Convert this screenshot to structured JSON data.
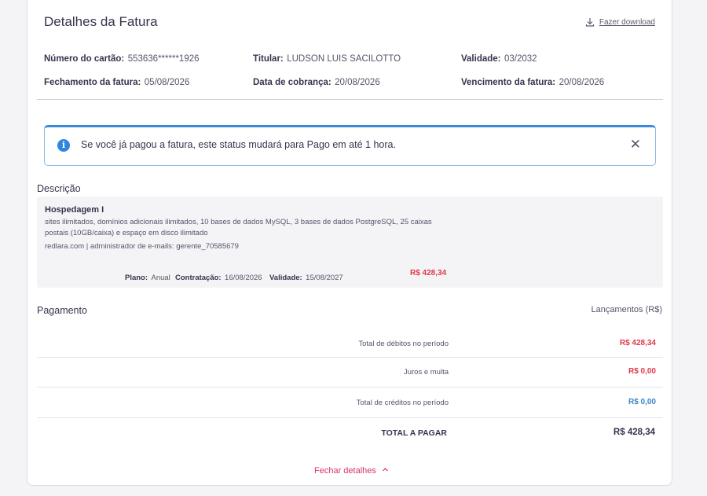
{
  "header": {
    "title": "Detalhes da Fatura",
    "download_label": "Fazer download",
    "download_icon": "download-icon"
  },
  "card_info": {
    "card_number_label": "Número do cartão:",
    "card_number_value": "553636******1926",
    "holder_label": "Titular:",
    "holder_value": "LUDSON LUIS SACILOTTO",
    "validity_label": "Validade:",
    "validity_value": "03/2032",
    "closing_label": "Fechamento da fatura:",
    "closing_value": "05/08/2026",
    "billing_label": "Data de cobrança:",
    "billing_value": "20/08/2026",
    "due_label": "Vencimento da fatura:",
    "due_value": "20/08/2026"
  },
  "alert": {
    "icon": "info-icon",
    "text": "Se você já pagou a fatura, este status mudará para Pago em até 1 hora.",
    "close_icon": "close-icon"
  },
  "description": {
    "section_title": "Descrição",
    "item_name": "Hospedagem I",
    "item_details": "sites ilimitados, domínios adicionais ilimitados, 10 bases de dados MySQL, 3 bases de dados PostgreSQL, 25 caixas postais (10GB/caixa) e espaço em disco ilimitado",
    "domain_line": "redlara.com | administrador de e-mails: gerente_70585679",
    "plan_label": "Plano:",
    "plan_value": "Anual",
    "contract_label": "Contratação:",
    "contract_value": "16/08/2026",
    "validity_label": "Validade:",
    "validity_value": "15/08/2027",
    "price": "R$ 428,34"
  },
  "payment": {
    "section_title": "Pagamento",
    "column_header": "Lançamentos (R$)",
    "rows": [
      {
        "label": "Total de débitos no período",
        "value": "R$ 428,34"
      },
      {
        "label": "Juros e multa",
        "value": "R$ 0,00"
      },
      {
        "label": "Total de créditos no período",
        "value": "R$ 0,00"
      }
    ],
    "total_label": "TOTAL A PAGAR",
    "total_value": "R$ 428,34"
  },
  "footer": {
    "close_label": "Fechar detalhes",
    "close_icon": "chevron-up-icon"
  },
  "colors": {
    "accent_red": "#e0374a",
    "accent_blue": "#3a86c8",
    "link_pink": "#d6336c",
    "info_blue": "#2f86dd"
  }
}
